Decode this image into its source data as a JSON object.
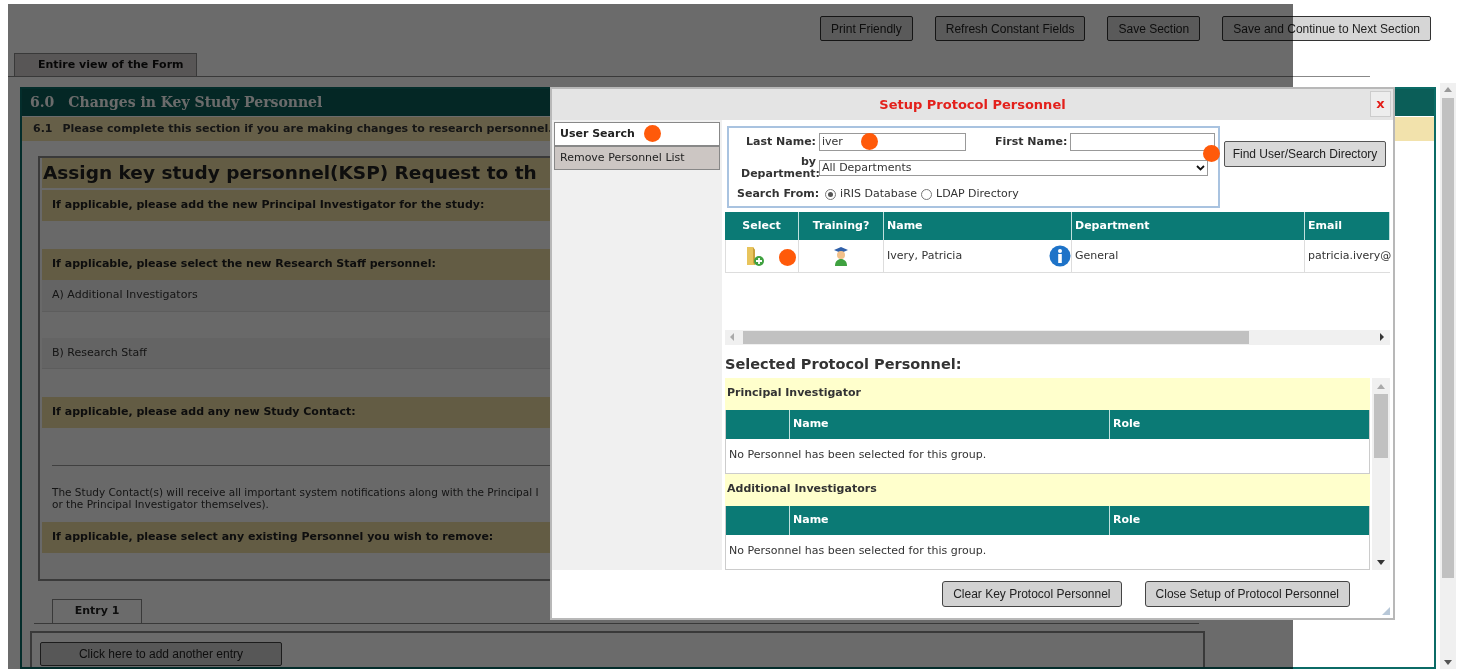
{
  "toolbar_buttons": [
    "Print Friendly",
    "Refresh Constant Fields",
    "Save Section",
    "Save and Continue to Next Section"
  ],
  "form_tab": {
    "label": "Entire view of the Form"
  },
  "section": {
    "number": "6.0",
    "title": "Changes in Key Study Personnel",
    "subsection_number": "6.1",
    "subsection_text": "Please complete this section if you are making changes to research personnel."
  },
  "form": {
    "heading": "Assign key study personnel(KSP) Request to th",
    "rows": [
      {
        "kind": "question",
        "text": "If applicable, please add the new Principal Investigator for the study:"
      },
      {
        "kind": "blank"
      },
      {
        "kind": "question",
        "text": "If applicable, please select the new Research Staff personnel:"
      },
      {
        "kind": "label",
        "text": "A) Additional Investigators"
      },
      {
        "kind": "blank"
      },
      {
        "kind": "label",
        "text": "B) Research Staff"
      },
      {
        "kind": "blank"
      },
      {
        "kind": "question",
        "text": "If applicable, please add any new Study Contact:"
      },
      {
        "kind": "rule"
      },
      {
        "kind": "note",
        "lines": [
          "The Study Contact(s) will receive all important system notifications along with the Principal I",
          "or the Principal Investigator themselves)."
        ]
      },
      {
        "kind": "question",
        "text": "If applicable, please select any existing Personnel you wish to remove:"
      },
      {
        "kind": "blank"
      }
    ]
  },
  "entry_tabs": [
    {
      "label": "Entry 1",
      "selected": true
    }
  ],
  "add_entry_button": "Click here to add another entry",
  "dialog": {
    "title": "Setup Protocol Personnel",
    "close_label": "x",
    "nav": [
      {
        "label": "User Search",
        "selected": true
      },
      {
        "label": "Remove Personnel List",
        "selected": false
      }
    ],
    "search": {
      "last_name_label": "Last Name:",
      "last_name_value": "iver",
      "first_name_label": "First Name:",
      "department_label": "by Department:",
      "department_value": "All Departments",
      "search_from_label": "Search From:",
      "sources": [
        {
          "label": "iRIS Database",
          "selected": true
        },
        {
          "label": "LDAP Directory",
          "selected": false
        }
      ]
    },
    "find_button": "Find User/Search Directory",
    "results": {
      "columns": [
        "Select",
        "Training?",
        "Name",
        "Department",
        "Email"
      ],
      "rows": [
        {
          "name": "Ivery, Patricia",
          "department": "General",
          "email": "patricia.ivery@"
        }
      ]
    },
    "selected_heading": "Selected Protocol Personnel:",
    "groups": [
      {
        "title": "Principal Investigator",
        "columns": [
          "Name",
          "Role"
        ],
        "empty_text": "No Personnel has been selected for this group."
      },
      {
        "title": "Additional Investigators",
        "columns": [
          "Name",
          "Role"
        ],
        "empty_text": "No Personnel has been selected for this group."
      }
    ],
    "buttons": [
      "Clear Key Protocol Personnel",
      "Close Setup of Protocol Personnel"
    ]
  }
}
